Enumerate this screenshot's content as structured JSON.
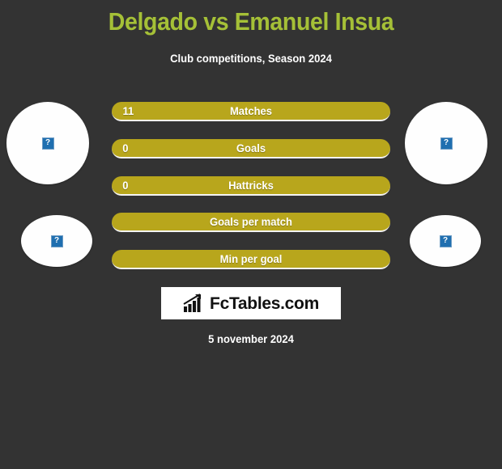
{
  "colors": {
    "background": "#333333",
    "title": "#a5c037",
    "bar": "#b8a61c",
    "bar_text": "#ffffff",
    "avatar": "#fefefe",
    "logo_background": "#ffffff",
    "logo_text": "#111111",
    "placeholder": "#1f6fb0"
  },
  "header": {
    "title": "Delgado vs Emanuel Insua",
    "subtitle": "Club competitions, Season 2024"
  },
  "avatars": [
    {
      "side": "left",
      "size": "big",
      "icon": "broken-image-icon",
      "glyph": "?"
    },
    {
      "side": "right",
      "size": "big",
      "icon": "broken-image-icon",
      "glyph": "?"
    },
    {
      "side": "left",
      "size": "small",
      "icon": "broken-image-icon",
      "glyph": "?"
    },
    {
      "side": "right",
      "size": "small",
      "icon": "broken-image-icon",
      "glyph": "?"
    }
  ],
  "stats": [
    {
      "label": "Matches",
      "left": "11",
      "right": ""
    },
    {
      "label": "Goals",
      "left": "0",
      "right": ""
    },
    {
      "label": "Hattricks",
      "left": "0",
      "right": ""
    },
    {
      "label": "Goals per match",
      "left": "",
      "right": ""
    },
    {
      "label": "Min per goal",
      "left": "",
      "right": ""
    }
  ],
  "logo": {
    "icon": "bar-chart-growth-icon",
    "text": "FcTables.com"
  },
  "footer": {
    "date": "5 november 2024"
  }
}
